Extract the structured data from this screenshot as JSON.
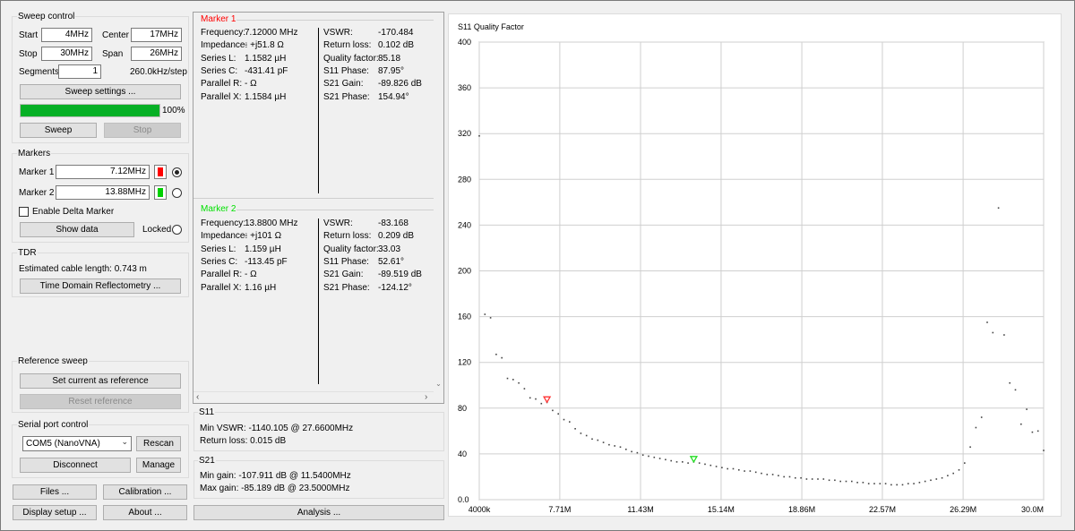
{
  "sweep_control": {
    "title": "Sweep control",
    "start_label": "Start",
    "start_value": "4MHz",
    "center_label": "Center",
    "center_value": "17MHz",
    "stop_label": "Stop",
    "stop_value": "30MHz",
    "span_label": "Span",
    "span_value": "26MHz",
    "segments_label": "Segments",
    "segments_value": "1",
    "step_text": "260.0kHz/step",
    "settings_button": "Sweep settings ...",
    "progress_percent": 100,
    "progress_text": "100%",
    "sweep_button": "Sweep",
    "stop_button": "Stop"
  },
  "markers": {
    "title": "Markers",
    "marker1_label": "Marker 1",
    "marker1_value": "7.12MHz",
    "marker1_color": "#ff0000",
    "marker2_label": "Marker 2",
    "marker2_value": "13.88MHz",
    "marker2_color": "#00d000",
    "delta_label": "Enable Delta Marker",
    "show_data_button": "Show data",
    "locked_label": "Locked"
  },
  "tdr": {
    "title": "TDR",
    "cable_text": "Estimated cable length:  0.743 m",
    "button": "Time Domain Reflectometry ..."
  },
  "reference": {
    "title": "Reference sweep",
    "set_button": "Set current as reference",
    "reset_button": "Reset reference"
  },
  "serial": {
    "title": "Serial port control",
    "port_value": "COM5 (NanoVNA)",
    "rescan_button": "Rescan",
    "disconnect_button": "Disconnect",
    "manage_button": "Manage"
  },
  "bottom_buttons": {
    "files": "Files ...",
    "calibration": "Calibration ...",
    "display": "Display setup ...",
    "about": "About ...",
    "analysis": "Analysis ..."
  },
  "marker_panels": [
    {
      "title": "Marker 1",
      "title_color": "#ff0000",
      "left": [
        [
          "Frequency:",
          "7.12000 MHz"
        ],
        [
          "Impedance:",
          "- +j51.8 Ω"
        ],
        [
          "Series L:",
          "1.1582 µH"
        ],
        [
          "Series C:",
          "-431.41 pF"
        ],
        [
          "Parallel R:",
          "- Ω"
        ],
        [
          "Parallel X:",
          "1.1584 µH"
        ]
      ],
      "right": [
        [
          "VSWR:",
          "-170.484"
        ],
        [
          "Return loss:",
          "0.102 dB"
        ],
        [
          "Quality factor:",
          "85.18"
        ],
        [
          "S11 Phase:",
          "87.95°"
        ],
        [
          "S21 Gain:",
          "-89.826 dB"
        ],
        [
          "S21 Phase:",
          "154.94°"
        ]
      ]
    },
    {
      "title": "Marker 2",
      "title_color": "#00e000",
      "left": [
        [
          "Frequency:",
          "13.8800 MHz"
        ],
        [
          "Impedance:",
          "- +j101 Ω"
        ],
        [
          "Series L:",
          "1.159 µH"
        ],
        [
          "Series C:",
          "-113.45 pF"
        ],
        [
          "Parallel R:",
          "- Ω"
        ],
        [
          "Parallel X:",
          "1.16 µH"
        ]
      ],
      "right": [
        [
          "VSWR:",
          "-83.168"
        ],
        [
          "Return loss:",
          "0.209 dB"
        ],
        [
          "Quality factor:",
          "33.03"
        ],
        [
          "S11 Phase:",
          "52.61°"
        ],
        [
          "S21 Gain:",
          "-89.519 dB"
        ],
        [
          "S21 Phase:",
          "-124.12°"
        ]
      ]
    }
  ],
  "s11_summary": {
    "title": "S11",
    "min_vswr": "Min VSWR:  -1140.105 @ 27.6600MHz",
    "return_loss": "Return loss:  0.015 dB"
  },
  "s21_summary": {
    "title": "S21",
    "min_gain": "Min gain:  -107.911 dB @ 11.5400MHz",
    "max_gain": "Max gain:  -85.189 dB @ 23.5000MHz"
  },
  "chart_data": {
    "type": "scatter",
    "title": "S11 Quality Factor",
    "xlabel": "",
    "ylabel": "",
    "x_unit": "MHz",
    "xlim": [
      4.0,
      30.0
    ],
    "ylim": [
      0,
      400
    ],
    "grid": true,
    "x_ticks": [
      {
        "value": 4.0,
        "label": "4000k"
      },
      {
        "value": 7.71,
        "label": "7.71M"
      },
      {
        "value": 11.43,
        "label": "11.43M"
      },
      {
        "value": 15.14,
        "label": "15.14M"
      },
      {
        "value": 18.86,
        "label": "18.86M"
      },
      {
        "value": 22.57,
        "label": "22.57M"
      },
      {
        "value": 26.29,
        "label": "26.29M"
      },
      {
        "value": 30.0,
        "label": "30.0M"
      }
    ],
    "y_ticks": [
      {
        "value": 0,
        "label": "0.0"
      },
      {
        "value": 40,
        "label": "40"
      },
      {
        "value": 80,
        "label": "80"
      },
      {
        "value": 120,
        "label": "120"
      },
      {
        "value": 160,
        "label": "160"
      },
      {
        "value": 200,
        "label": "200"
      },
      {
        "value": 240,
        "label": "240"
      },
      {
        "value": 280,
        "label": "280"
      },
      {
        "value": 320,
        "label": "320"
      },
      {
        "value": 360,
        "label": "360"
      },
      {
        "value": 400,
        "label": "400"
      }
    ],
    "series": [
      {
        "color": "#444444",
        "x": [
          4.0,
          4.26,
          4.52,
          4.78,
          5.04,
          5.3,
          5.56,
          5.82,
          6.08,
          6.34,
          6.6,
          6.86,
          7.12,
          7.38,
          7.64,
          7.9,
          8.16,
          8.42,
          8.68,
          8.94,
          9.2,
          9.46,
          9.72,
          9.98,
          10.24,
          10.5,
          10.76,
          11.02,
          11.28,
          11.54,
          11.8,
          12.06,
          12.32,
          12.58,
          12.84,
          13.1,
          13.36,
          13.62,
          13.88,
          14.14,
          14.4,
          14.66,
          14.92,
          15.18,
          15.44,
          15.7,
          15.96,
          16.22,
          16.48,
          16.74,
          17.0,
          17.26,
          17.52,
          17.78,
          18.04,
          18.3,
          18.56,
          18.82,
          19.08,
          19.34,
          19.6,
          19.86,
          20.12,
          20.38,
          20.64,
          20.9,
          21.16,
          21.42,
          21.68,
          21.94,
          22.2,
          22.46,
          22.72,
          22.98,
          23.24,
          23.5,
          23.76,
          24.02,
          24.28,
          24.54,
          24.8,
          25.06,
          25.32,
          25.58,
          25.84,
          26.1,
          26.36,
          26.62,
          26.88,
          27.14,
          27.4,
          27.66,
          27.92,
          28.18,
          28.44,
          28.7,
          28.96,
          29.22,
          29.48,
          29.74,
          30.0
        ],
        "y": [
          318,
          162,
          159,
          127,
          124,
          106,
          105,
          102,
          97,
          89,
          88,
          84,
          85,
          78,
          75,
          70,
          68,
          62,
          58,
          56,
          53,
          52,
          50,
          48,
          47,
          46,
          44,
          42,
          41,
          39,
          38,
          37,
          36,
          35,
          34,
          33,
          33,
          32,
          33,
          32,
          31,
          30,
          29,
          28,
          27,
          27,
          26,
          25,
          25,
          24,
          23,
          22,
          22,
          21,
          20,
          20,
          19,
          19,
          18,
          18,
          18,
          18,
          17,
          17,
          16,
          16,
          16,
          15,
          15,
          14,
          14,
          14,
          14,
          13,
          13,
          13,
          14,
          14,
          15,
          16,
          17,
          18,
          19,
          21,
          23,
          26,
          32,
          46,
          63,
          72,
          155,
          146,
          255,
          144,
          102,
          96,
          66,
          79,
          59,
          60,
          43
        ]
      }
    ],
    "markers": [
      {
        "name": "Marker 1",
        "x": 7.12,
        "y": 85.18,
        "color": "#ff3333"
      },
      {
        "name": "Marker 2",
        "x": 13.88,
        "y": 33.03,
        "color": "#22dd22"
      }
    ]
  }
}
